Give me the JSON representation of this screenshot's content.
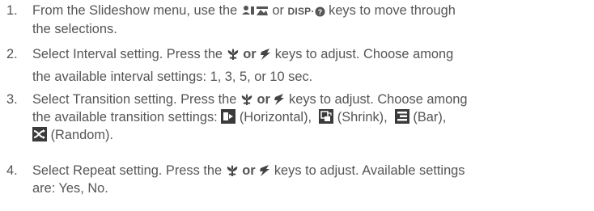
{
  "steps": [
    {
      "num": "1.",
      "a": "From the Slideshow menu, use the",
      "or": "or",
      "disp": "DISP·",
      "b": "keys to move through",
      "line2": "the selections."
    },
    {
      "num": "2.",
      "a": "Select Interval setting. Press the",
      "or": "or",
      "b": "keys to adjust. Choose among",
      "line2": "the available interval settings: 1, 3, 5, or 10 sec."
    },
    {
      "num": "3.",
      "a": "Select Transition setting. Press the",
      "or": "or",
      "b": "keys to adjust. Choose among",
      "c": "the available transition settings:",
      "horizontal": "(Horizontal),",
      "shrink": "(Shrink),",
      "bar": "(Bar),",
      "random": "(Random)."
    },
    {
      "num": "4.",
      "a": "Select Repeat setting. Press the",
      "or": "or",
      "b": "keys to adjust. Available settings",
      "line2": "are: Yes, No."
    }
  ],
  "icons": {
    "portrait_landscape": "portrait-landscape-icon",
    "info": "info-icon",
    "macro": "macro-flower-icon",
    "flash": "flash-icon",
    "horizontal": "horizontal-transition-icon",
    "shrink": "shrink-transition-icon",
    "bar": "bar-transition-icon",
    "random": "random-transition-icon"
  },
  "colors": {
    "text": "#555555",
    "icon": "#3a3a3a"
  }
}
